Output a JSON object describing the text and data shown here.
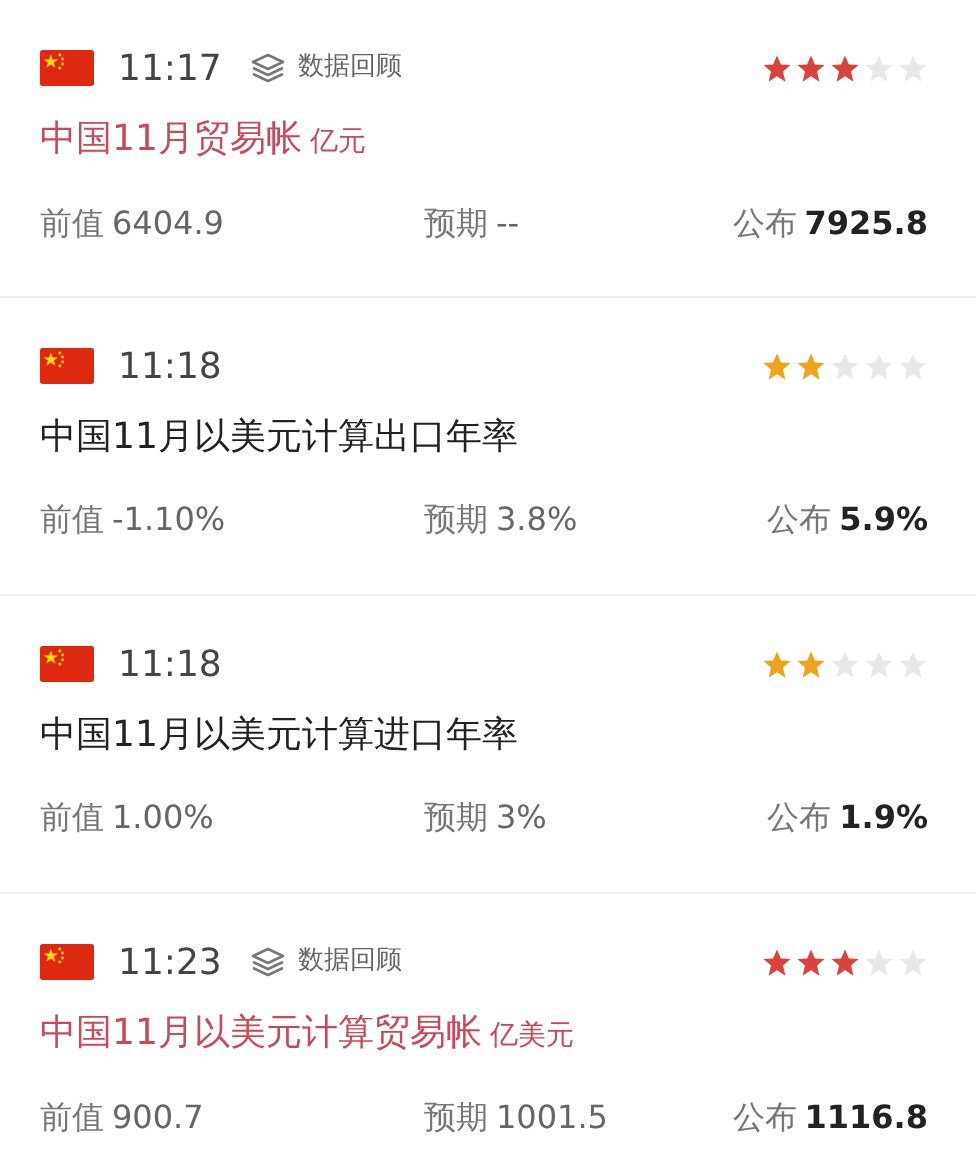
{
  "events": [
    {
      "time": "11:17",
      "review": "数据回顾",
      "stars": 3,
      "important": true,
      "title": "中国11月贸易帐",
      "unit": "亿元",
      "previous_label": "前值",
      "previous": "6404.9",
      "forecast_label": "预期",
      "forecast": "--",
      "actual_label": "公布",
      "actual": "7925.8"
    },
    {
      "time": "11:18",
      "stars": 2,
      "important": false,
      "title": "中国11月以美元计算出口年率",
      "previous_label": "前值",
      "previous": "-1.10%",
      "forecast_label": "预期",
      "forecast": "3.8%",
      "actual_label": "公布",
      "actual": "5.9%"
    },
    {
      "time": "11:18",
      "stars": 2,
      "important": false,
      "title": "中国11月以美元计算进口年率",
      "previous_label": "前值",
      "previous": "1.00%",
      "forecast_label": "预期",
      "forecast": "3%",
      "actual_label": "公布",
      "actual": "1.9%"
    },
    {
      "time": "11:23",
      "review": "数据回顾",
      "stars": 3,
      "important": true,
      "title": "中国11月以美元计算贸易帐",
      "unit": "亿美元",
      "previous_label": "前值",
      "previous": "900.7",
      "forecast_label": "预期",
      "forecast": "1001.5",
      "actual_label": "公布",
      "actual": "1116.8"
    }
  ]
}
